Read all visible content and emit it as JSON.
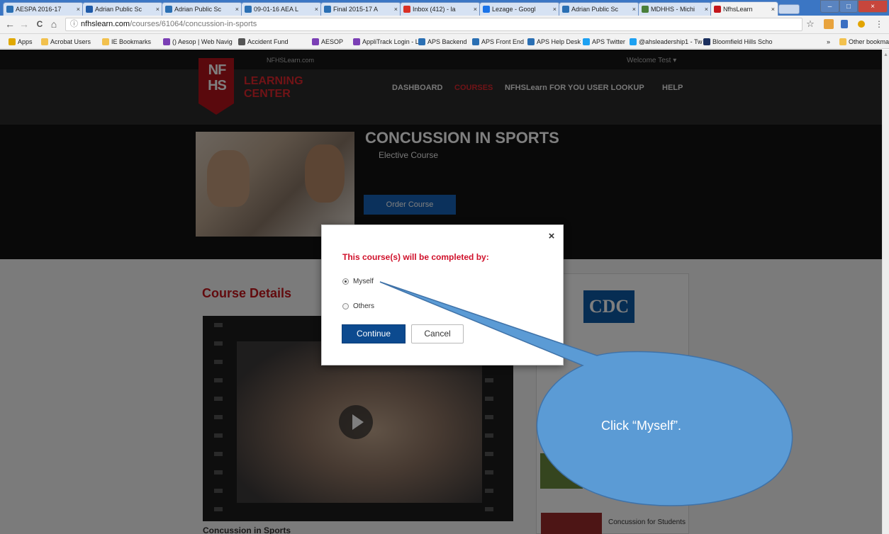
{
  "browser": {
    "tabs": [
      {
        "label": "AESPA 2016-17",
        "icon_color": "#2a6fb3",
        "active": false
      },
      {
        "label": "Adrian Public Sc",
        "icon_color": "#1e5aa8",
        "active": false
      },
      {
        "label": "Adrian Public Sc",
        "icon_color": "#2a6fb3",
        "active": false
      },
      {
        "label": "09-01-16 AEA L",
        "icon_color": "#2a6fb3",
        "active": false
      },
      {
        "label": "Final 2015-17 A",
        "icon_color": "#2a6fb3",
        "active": false
      },
      {
        "label": "Inbox (412) - la",
        "icon_color": "#d93025",
        "active": false
      },
      {
        "label": "Lezage - Googl",
        "icon_color": "#1a73e8",
        "active": false
      },
      {
        "label": "Adrian Public Sc",
        "icon_color": "#2a6fb3",
        "active": false
      },
      {
        "label": "MDHHS - Michi",
        "icon_color": "#4a7f3a",
        "active": false
      },
      {
        "label": "NfhsLearn",
        "icon_color": "#c4161c",
        "active": true
      }
    ],
    "tab_close_glyph": "×",
    "window_controls": {
      "minimize": "–",
      "maximize": "□",
      "close": "×"
    },
    "nav": {
      "back": "←",
      "forward": "→",
      "reload": "C",
      "home": "⌂"
    },
    "url_host": "nfhslearn.com",
    "url_path": "/courses/61064/concussion-in-sports",
    "bookmarks": [
      {
        "label": "Apps",
        "icon_color": "#e0a800"
      },
      {
        "label": "Acrobat Users",
        "icon_color": "#f2c14e"
      },
      {
        "label": "IE Bookmarks",
        "icon_color": "#f2c14e"
      },
      {
        "label": "() Aesop | Web Navig",
        "icon_color": "#7b3fb5"
      },
      {
        "label": "Accident Fund",
        "icon_color": "#555555"
      },
      {
        "label": "AESOP",
        "icon_color": "#7b3fb5"
      },
      {
        "label": "AppliTrack Login - Le",
        "icon_color": "#7b3fb5"
      },
      {
        "label": "APS Backend",
        "icon_color": "#2a6fb3"
      },
      {
        "label": "APS Front End",
        "icon_color": "#2a6fb3"
      },
      {
        "label": "APS Help Desk",
        "icon_color": "#2a6fb3"
      },
      {
        "label": "APS Twitter",
        "icon_color": "#1da1f2"
      },
      {
        "label": "@ahsleadership1 - Tw",
        "icon_color": "#1da1f2"
      },
      {
        "label": "Bloomfield Hills Scho",
        "icon_color": "#1b2f5e"
      },
      {
        "label": "»",
        "icon_color": ""
      },
      {
        "label": "Other bookmarks",
        "icon_color": "#f2c14e"
      }
    ]
  },
  "page": {
    "top_link": "NFHSLearn.com",
    "welcome": "Welcome Test ▾",
    "logo_letters": "NF HS",
    "learning": "LEARNING",
    "center": "CENTER",
    "nav_items": [
      "DASHBOARD",
      "COURSES",
      "NFHSLearn FOR YOU",
      "USER LOOKUP",
      "HELP"
    ],
    "course_title": "CONCUSSION IN SPORTS",
    "course_type": "Elective Course",
    "order_button": "Order Course",
    "course_details_heading": "Course Details",
    "video_caption": "Concussion in Sports",
    "cdc_logo": "CDC",
    "side_item": "Concussion for Students"
  },
  "modal": {
    "title": "This course(s) will be completed by:",
    "options": [
      {
        "label": "Myself",
        "checked": true
      },
      {
        "label": "Others",
        "checked": false
      }
    ],
    "continue_label": "Continue",
    "cancel_label": "Cancel",
    "close_glyph": "×"
  },
  "callout": {
    "text": "Click “Myself”.",
    "color": "#5b9bd5"
  }
}
